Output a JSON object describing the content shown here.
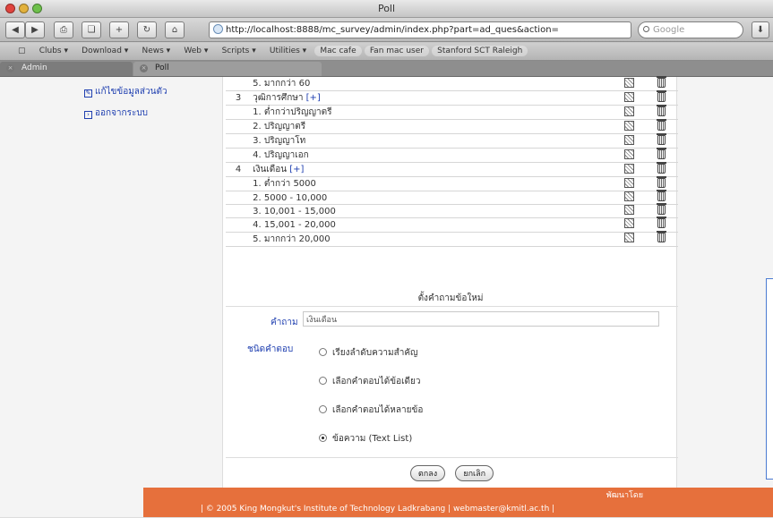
{
  "window": {
    "title": "Poll"
  },
  "toolbar": {
    "back_glyph": "◀",
    "forward_glyph": "▶",
    "url": "http://localhost:8888/mc_survey/admin/index.php?part=ad_ques&action=",
    "search_placeholder": "Google"
  },
  "bookmarks": [
    "Clubs ▾",
    "Download ▾",
    "News ▾",
    "Web ▾",
    "Scripts ▾",
    "Utilities ▾",
    "Mac cafe",
    "Fan mac user",
    "Stanford SCT Raleigh"
  ],
  "tabs": {
    "admin": "Admin",
    "poll": "Poll"
  },
  "sidebar": {
    "items": [
      {
        "label": "แก้ไขข้อมูลส่วนตัว"
      },
      {
        "label": "ออกจากระบบ"
      }
    ]
  },
  "question_rows": [
    {
      "num": "",
      "text": "5. มากกว่า 60",
      "add": ""
    },
    {
      "num": "3",
      "text": "วุฒิการศึกษา",
      "add": "[+]"
    },
    {
      "num": "",
      "text": "1. ต่ำกว่าปริญญาตรี",
      "add": ""
    },
    {
      "num": "",
      "text": "2. ปริญญาตรี",
      "add": ""
    },
    {
      "num": "",
      "text": "3. ปริญญาโท",
      "add": ""
    },
    {
      "num": "",
      "text": "4. ปริญญาเอก",
      "add": ""
    },
    {
      "num": "4",
      "text": "เงินเดือน",
      "add": "[+]"
    },
    {
      "num": "",
      "text": "1. ต่ำกว่า 5000",
      "add": ""
    },
    {
      "num": "",
      "text": "2. 5000 - 10,000",
      "add": ""
    },
    {
      "num": "",
      "text": "3. 10,001 - 15,000",
      "add": ""
    },
    {
      "num": "",
      "text": "4. 15,001 - 20,000",
      "add": ""
    },
    {
      "num": "",
      "text": "5. มากกว่า 20,000",
      "add": ""
    }
  ],
  "form": {
    "title": "ตั้งคำถามข้อใหม่",
    "question_label": "คำถาม",
    "question_value": "เงินเดือน",
    "type_label": "ชนิดคำตอบ",
    "options": [
      {
        "label": "เรียงลำดับความสำคัญ",
        "selected": false
      },
      {
        "label": "เลือกคำตอบได้ข้อเดียว",
        "selected": false
      },
      {
        "label": "เลือกคำตอบได้หลายข้อ",
        "selected": false
      },
      {
        "label": "ข้อความ (Text List)",
        "selected": true
      }
    ],
    "submit_label": "ตกลง",
    "cancel_label": "ยกเลิก"
  },
  "footer": {
    "credit": "พัฒนาโดย",
    "copyright": "| © 2005 King Mongkut's Institute of Technology Ladkrabang | webmaster@kmitl.ac.th |"
  },
  "colors": {
    "footer_bg": "#e6703c",
    "link": "#1f3fb0"
  }
}
